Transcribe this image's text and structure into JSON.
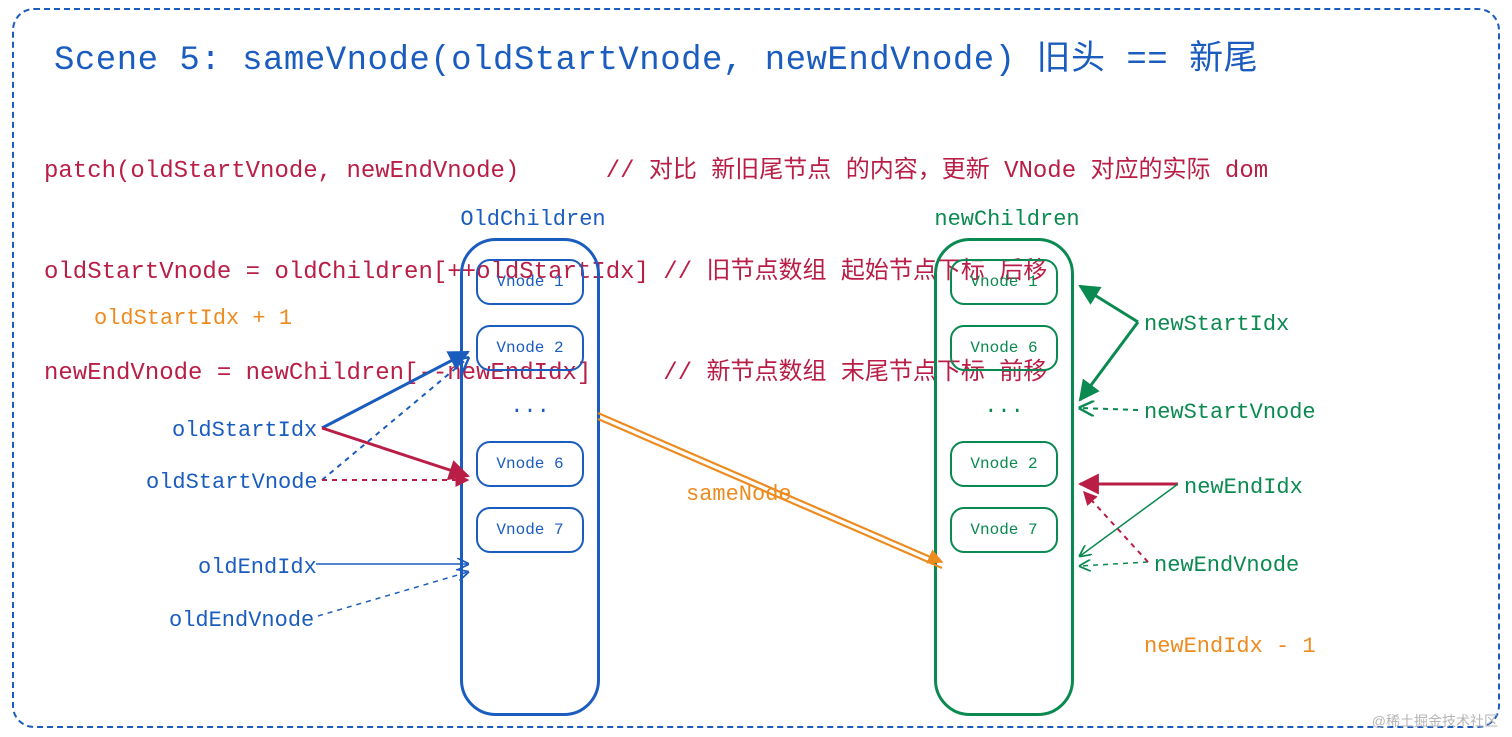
{
  "title": "Scene 5: sameVnode(oldStartVnode, newEndVnode) 旧头 == 新尾",
  "code": {
    "line1": "patch(oldStartVnode, newEndVnode)      // 对比 新旧尾节点 的内容，更新 VNode 对应的实际 dom",
    "line2": "oldStartVnode = oldChildren[++oldStartIdx] // 旧节点数组 起始节点下标 后移",
    "line3": "newEndVnode = newChildren[--newEndIdx]     // 新节点数组 末尾节点下标 前移"
  },
  "old": {
    "label": "OldChildren",
    "items": [
      "Vnode 1",
      "Vnode 2",
      "...",
      "Vnode 6",
      "Vnode 7"
    ]
  },
  "new": {
    "label": "newChildren",
    "items": [
      "Vnode 1",
      "Vnode 6",
      "...",
      "Vnode 2",
      "Vnode 7"
    ]
  },
  "labels": {
    "oldStartIdxPlus": "oldStartIdx + 1",
    "oldStartIdx": "oldStartIdx",
    "oldStartVnode": "oldStartVnode",
    "oldEndIdx": "oldEndIdx",
    "oldEndVnode": "oldEndVnode",
    "sameNode": "sameNode",
    "newStartIdx": "newStartIdx",
    "newStartVnode": "newStartVnode",
    "newEndIdx": "newEndIdx",
    "newEndVnode": "newEndVnode",
    "newEndIdxMinus": "newEndIdx - 1"
  },
  "watermark": "@稀土掘金技术社区",
  "colors": {
    "blue": "#1b5cbf",
    "green": "#0a8a50",
    "orange": "#ed8b1f",
    "crimson": "#b91e46"
  }
}
